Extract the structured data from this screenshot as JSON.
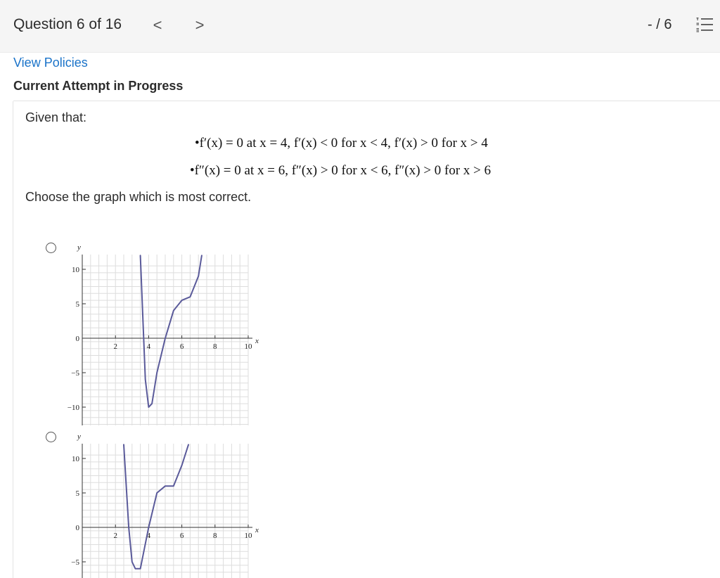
{
  "header": {
    "question_title": "Question 6 of 16",
    "prev_glyph": "<",
    "next_glyph": ">",
    "score": "- / 6"
  },
  "links": {
    "view_policies": "View Policies"
  },
  "status": {
    "attempt": "Current Attempt in Progress"
  },
  "question": {
    "intro": "Given that:",
    "condition_1": "•f′(x) = 0 at x = 4, f′(x) < 0 for x < 4, f′(x) > 0 for x > 4",
    "condition_2": "•f″(x) = 0 at x = 6, f″(x) > 0 for x < 6, f″(x) > 0 for x > 6",
    "prompt": "Choose the graph which is most correct."
  },
  "graph_axes": {
    "x_label": "x",
    "y_label": "y",
    "x_ticks": [
      "2",
      "4",
      "6",
      "8",
      "10"
    ],
    "y_ticks": [
      "10",
      "5",
      "0",
      "−5",
      "−10"
    ]
  },
  "chart_data": [
    {
      "type": "line",
      "xlabel": "x",
      "ylabel": "y",
      "xlim": [
        0,
        10
      ],
      "ylim": [
        -12,
        12
      ],
      "series": [
        {
          "x": [
            3.5,
            3.8,
            4.0,
            4.2,
            4.5,
            5.0,
            5.5,
            6.0,
            6.5,
            7.0,
            7.2
          ],
          "y": [
            12,
            -6,
            -10,
            -9.5,
            -5,
            0,
            4,
            5.5,
            6,
            9,
            12
          ]
        }
      ]
    },
    {
      "type": "line",
      "xlabel": "x",
      "ylabel": "y",
      "xlim": [
        0,
        10
      ],
      "ylim": [
        -6,
        12
      ],
      "series": [
        {
          "x": [
            2.5,
            2.8,
            3.0,
            3.2,
            3.5,
            4.0,
            4.5,
            5.0,
            5.5,
            6.0,
            6.4
          ],
          "y": [
            12,
            0,
            -5,
            -6,
            -6,
            0,
            5,
            6,
            6,
            9,
            12
          ]
        }
      ]
    }
  ],
  "colors": {
    "curve": "#5a5a9a",
    "link": "#1a73c9",
    "grid": "#dddddd"
  }
}
